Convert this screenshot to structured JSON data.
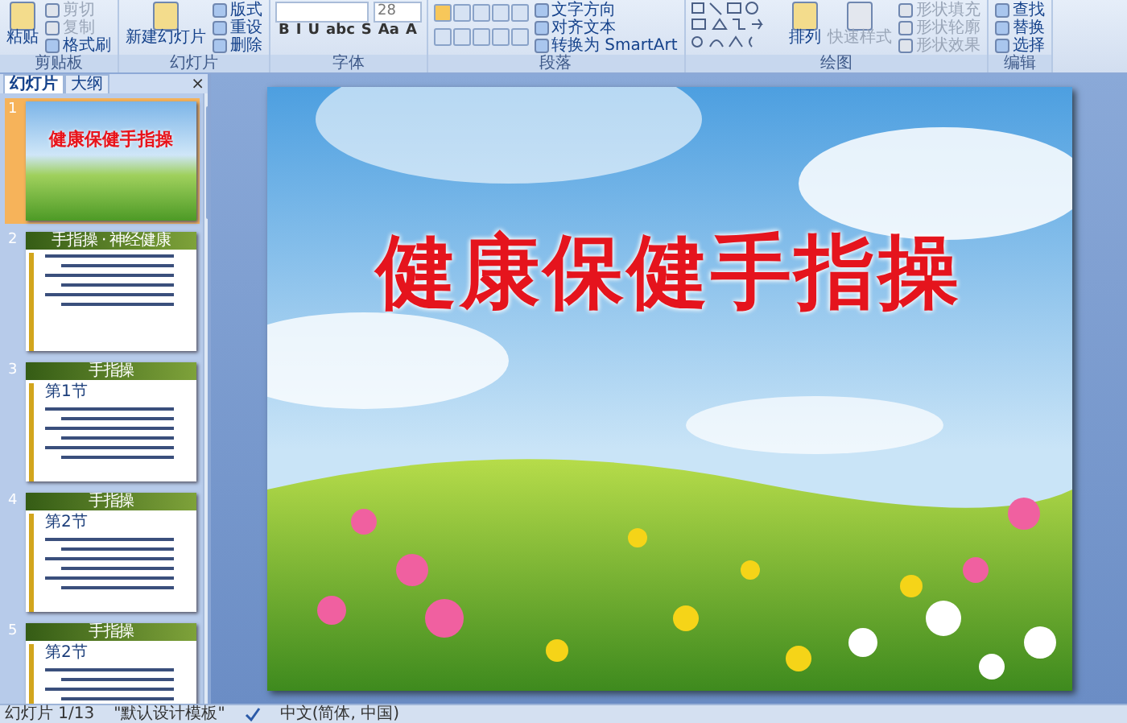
{
  "ribbon": {
    "groups": [
      {
        "kind": "clipboard",
        "label": "剪贴板",
        "large": {
          "label": "粘贴"
        },
        "buttons": [
          {
            "label": "剪切",
            "disabled": true
          },
          {
            "label": "复制",
            "disabled": true
          },
          {
            "label": "格式刷",
            "disabled": false
          }
        ]
      },
      {
        "kind": "slides",
        "label": "幻灯片",
        "large": {
          "label": "新建幻灯片"
        },
        "buttons": [
          {
            "label": "版式",
            "disabled": false
          },
          {
            "label": "重设",
            "disabled": false
          },
          {
            "label": "删除",
            "disabled": false
          }
        ]
      },
      {
        "kind": "font",
        "label": "字体",
        "size": "28",
        "glyphs": [
          "B",
          "I",
          "U",
          "abc",
          "S",
          "Aa",
          "A"
        ]
      },
      {
        "kind": "paragraph",
        "label": "段落",
        "buttons": [
          {
            "label": "文字方向",
            "disabled": false
          },
          {
            "label": "对齐文本",
            "disabled": false
          },
          {
            "label": "转换为 SmartArt",
            "disabled": false
          }
        ]
      },
      {
        "kind": "drawing",
        "label": "绘图",
        "large": {
          "label": "排列"
        },
        "quick": {
          "label": "快速样式",
          "disabled": true
        },
        "buttons": [
          {
            "label": "形状填充",
            "disabled": true
          },
          {
            "label": "形状轮廓",
            "disabled": true
          },
          {
            "label": "形状效果",
            "disabled": true
          }
        ]
      },
      {
        "kind": "editing",
        "label": "编辑",
        "buttons": [
          {
            "label": "查找",
            "disabled": false
          },
          {
            "label": "替换",
            "disabled": false
          },
          {
            "label": "选择",
            "disabled": false
          }
        ]
      }
    ]
  },
  "pane": {
    "tabs": [
      {
        "label": "幻灯片",
        "selected": true
      },
      {
        "label": "大纲",
        "selected": false
      }
    ],
    "close": "×",
    "thumbnails": [
      {
        "number": "1",
        "kind": "title",
        "title": "健康保健手指操",
        "selected": true
      },
      {
        "number": "2",
        "kind": "content",
        "title": "手指操 · 神经健康",
        "selected": false
      },
      {
        "number": "3",
        "kind": "content",
        "title": "手指操",
        "heading": "第1节",
        "selected": false
      },
      {
        "number": "4",
        "kind": "content",
        "title": "手指操",
        "heading": "第2节",
        "selected": false
      },
      {
        "number": "5",
        "kind": "content",
        "title": "手指操",
        "heading": "第2节",
        "selected": false
      }
    ]
  },
  "slide": {
    "title": "健康保健手指操"
  },
  "status_bar": {
    "slide": "幻灯片 1/13",
    "theme": "\"默认设计模板\"",
    "language": "中文(简体, 中国)"
  }
}
